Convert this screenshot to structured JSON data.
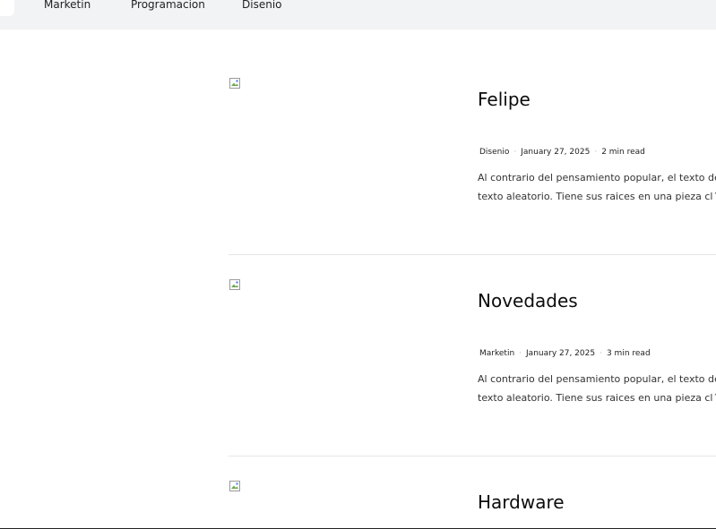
{
  "nav": {
    "items": [
      {
        "label": "Marketin"
      },
      {
        "label": "Programacion"
      },
      {
        "label": "Disenio"
      }
    ]
  },
  "posts": [
    {
      "title": "Felipe",
      "category": "Disenio",
      "date": "January 27, 2025",
      "read_time": "2 min read",
      "excerpt_line1": "Al contrario del pensamiento popular, el texto de L",
      "excerpt_line2": "texto aleatorio. Tiene sus raices en una pieza cl´sica"
    },
    {
      "title": "Novedades",
      "category": "Marketin",
      "date": "January 27, 2025",
      "read_time": "3 min read",
      "excerpt_line1": "Al contrario del pensamiento popular, el texto de L",
      "excerpt_line2": "texto aleatorio. Tiene sus raices en una pieza cl´sica"
    },
    {
      "title": "Hardware"
    }
  ],
  "meta_separator": "·",
  "icons": {
    "post_image": "broken-image-icon"
  }
}
